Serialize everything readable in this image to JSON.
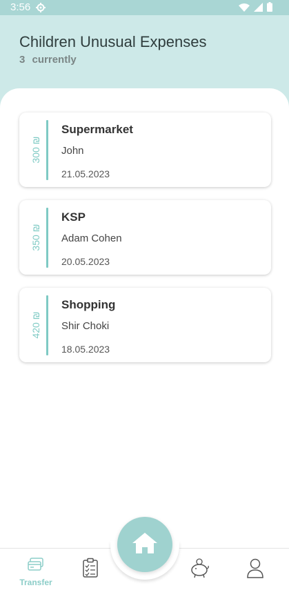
{
  "status_bar": {
    "time": "3:56"
  },
  "header": {
    "title": "Children Unusual Expenses",
    "count": "3",
    "count_suffix": "currently"
  },
  "expenses": [
    {
      "amount": "300 ₪",
      "store": "Supermarket",
      "person": "John",
      "date": "21.05.2023"
    },
    {
      "amount": "350 ₪",
      "store": "KSP",
      "person": "Adam Cohen",
      "date": "20.05.2023"
    },
    {
      "amount": "420 ₪",
      "store": "Shopping",
      "person": "Shir Choki",
      "date": "18.05.2023"
    }
  ],
  "bottom_nav": {
    "transfer_label": "Transfer",
    "icons": [
      "transfer-icon",
      "checklist-icon",
      "home-icon",
      "piggy-bank-icon",
      "profile-icon"
    ]
  },
  "colors": {
    "accent": "#7ecac4",
    "header_bg": "#cde9e8",
    "status_bar": "#a9d6d4",
    "home_button": "#9fd2cf"
  }
}
